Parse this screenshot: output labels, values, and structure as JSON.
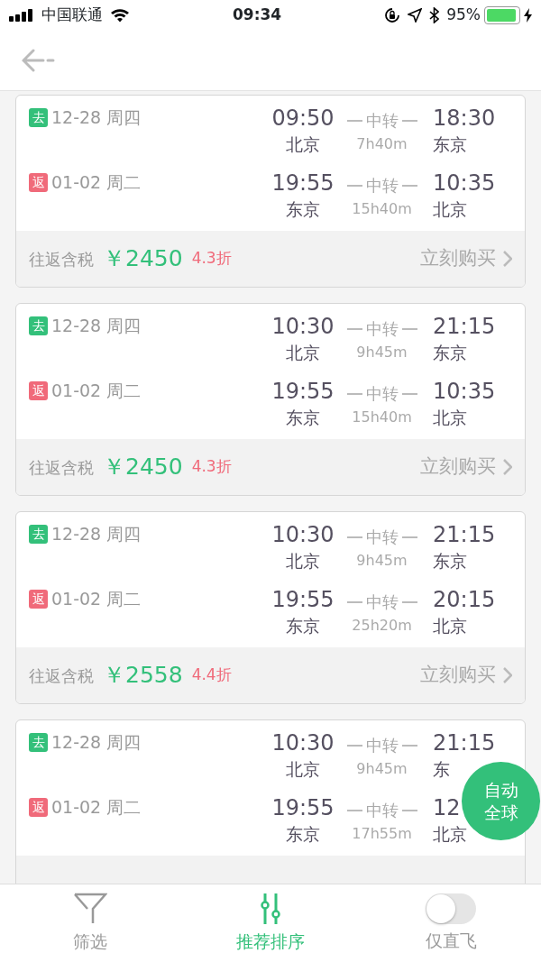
{
  "status_bar": {
    "carrier": "中国联通",
    "time": "09:34",
    "battery_text": "95%"
  },
  "flights": [
    {
      "legs": [
        {
          "kind": "go",
          "tag": "去",
          "date": "12-28 周四",
          "depart_time": "09:50",
          "depart_city": "北京",
          "via": "中转",
          "duration": "7h40m",
          "arrive_time": "18:30",
          "arrive_city": "东京"
        },
        {
          "kind": "return",
          "tag": "返",
          "date": "01-02 周二",
          "depart_time": "19:55",
          "depart_city": "东京",
          "via": "中转",
          "duration": "15h40m",
          "arrive_time": "10:35",
          "arrive_city": "北京"
        }
      ],
      "price_label": "往返含税",
      "price": "￥2450",
      "discount": "4.3折",
      "buy": "立刻购买"
    },
    {
      "legs": [
        {
          "kind": "go",
          "tag": "去",
          "date": "12-28 周四",
          "depart_time": "10:30",
          "depart_city": "北京",
          "via": "中转",
          "duration": "9h45m",
          "arrive_time": "21:15",
          "arrive_city": "东京"
        },
        {
          "kind": "return",
          "tag": "返",
          "date": "01-02 周二",
          "depart_time": "19:55",
          "depart_city": "东京",
          "via": "中转",
          "duration": "15h40m",
          "arrive_time": "10:35",
          "arrive_city": "北京"
        }
      ],
      "price_label": "往返含税",
      "price": "￥2450",
      "discount": "4.3折",
      "buy": "立刻购买"
    },
    {
      "legs": [
        {
          "kind": "go",
          "tag": "去",
          "date": "12-28 周四",
          "depart_time": "10:30",
          "depart_city": "北京",
          "via": "中转",
          "duration": "9h45m",
          "arrive_time": "21:15",
          "arrive_city": "东京"
        },
        {
          "kind": "return",
          "tag": "返",
          "date": "01-02 周二",
          "depart_time": "19:55",
          "depart_city": "东京",
          "via": "中转",
          "duration": "25h20m",
          "arrive_time": "20:15",
          "arrive_city": "北京"
        }
      ],
      "price_label": "往返含税",
      "price": "￥2558",
      "discount": "4.4折",
      "buy": "立刻购买"
    },
    {
      "legs": [
        {
          "kind": "go",
          "tag": "去",
          "date": "12-28 周四",
          "depart_time": "10:30",
          "depart_city": "北京",
          "via": "中转",
          "duration": "9h45m",
          "arrive_time": "21:15",
          "arrive_city": "东"
        },
        {
          "kind": "return",
          "tag": "返",
          "date": "01-02 周二",
          "depart_time": "19:55",
          "depart_city": "东京",
          "via": "中转",
          "duration": "17h55m",
          "arrive_time": "12",
          "arrive_city": "北京"
        }
      ]
    }
  ],
  "float_button": {
    "lines": [
      "自动",
      "全球"
    ]
  },
  "bottom_bar": [
    {
      "kind": "filter",
      "label": "筛选",
      "selected": false
    },
    {
      "kind": "sort",
      "label": "推荐排序",
      "selected": true
    },
    {
      "kind": "toggle",
      "label": "仅直飞",
      "on": false
    }
  ]
}
